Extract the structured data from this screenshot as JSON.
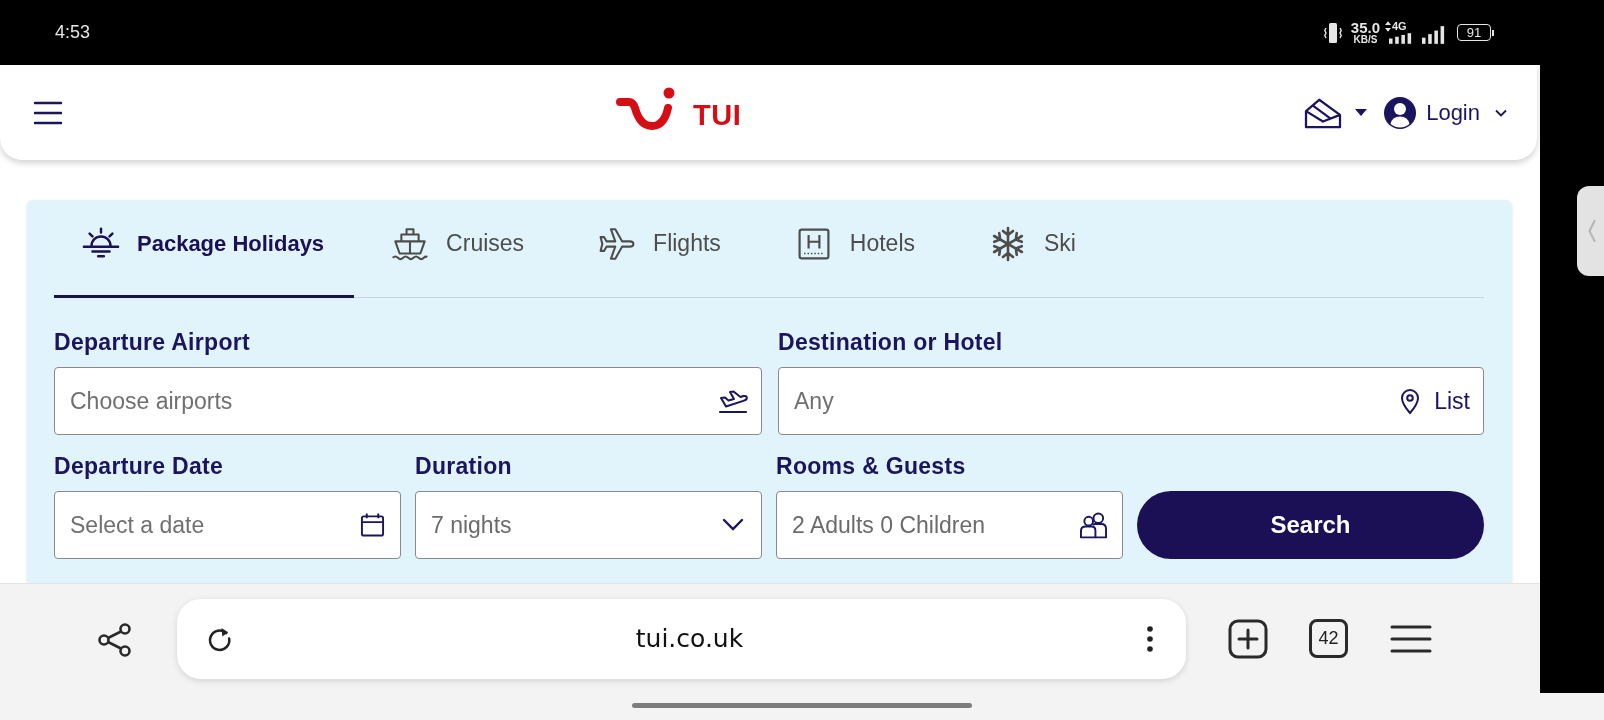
{
  "status_bar": {
    "time": "4:53",
    "speed": "35.0",
    "speed_unit": "KB/S",
    "network": "4G",
    "battery": "91"
  },
  "header": {
    "logo": "TUI",
    "login": "Login"
  },
  "search_panel": {
    "tabs": [
      {
        "kind": "package",
        "label": "Package Holidays",
        "selected": true
      },
      {
        "kind": "cruise",
        "label": "Cruises",
        "selected": false
      },
      {
        "kind": "flight",
        "label": "Flights",
        "selected": false
      },
      {
        "kind": "hotel",
        "label": "Hotels",
        "selected": false
      },
      {
        "kind": "ski",
        "label": "Ski",
        "selected": false
      }
    ],
    "fields": [
      {
        "kind": "airport",
        "label": "Departure Airport",
        "placeholder": "Choose airports"
      },
      {
        "kind": "destination",
        "label": "Destination or Hotel",
        "placeholder": "Any",
        "action": "List"
      },
      {
        "kind": "date",
        "label": "Departure Date",
        "placeholder": "Select a date"
      },
      {
        "kind": "duration",
        "label": "Duration",
        "value": "7 nights"
      },
      {
        "kind": "guests",
        "label": "Rooms & Guests",
        "value": "2 Adults 0 Children"
      }
    ],
    "search_button": "Search"
  },
  "browser_toolbar": {
    "url": "tui.co.uk",
    "tab_count": "42"
  }
}
